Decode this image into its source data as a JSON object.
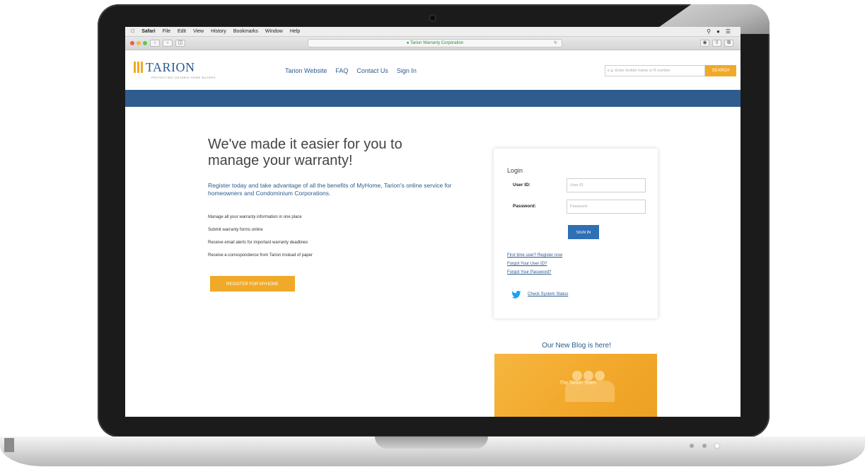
{
  "menubar": {
    "items": [
      "Safari",
      "File",
      "Edit",
      "View",
      "History",
      "Bookmarks",
      "Window",
      "Help"
    ]
  },
  "toolbar": {
    "address": "Tarion Warranty Corporation"
  },
  "header": {
    "logo_text": "TARION",
    "logo_tagline": "PROTECTING ONTARIO HOME BUYERS",
    "nav": [
      "Tarion Website",
      "FAQ",
      "Contact Us",
      "Sign In"
    ],
    "search_placeholder": "e.g. Enter builder name or B number",
    "search_button": "SEARCH"
  },
  "main": {
    "headline": "We've made it easier for you to manage your warranty!",
    "intro": "Register today and take advantage of all the benefits of MyHome, Tarion's online service for homeowners and Condominium Corporations.",
    "benefits": [
      "Manage all your warranty information in one place",
      "Submit warranty forms online",
      "Receive email alerts for important warranty deadlines",
      "Receive e-correspondence from Tarion instead of paper"
    ],
    "register_button": "REGISTER FOR MYHOME"
  },
  "login": {
    "title": "Login",
    "user_label": "User ID:",
    "user_placeholder": "User ID",
    "password_label": "Password:",
    "password_placeholder": "Password",
    "signin_button": "SIGN IN",
    "links": [
      "First time user? Register now",
      "Forgot Your User ID?",
      "Forgot Your Password?"
    ],
    "system_status": "Check System Status"
  },
  "blog": {
    "title": "Our New Blog is here!",
    "caption": "The Tarion Team"
  },
  "colors": {
    "brand_blue": "#2e5c8e",
    "accent_orange": "#f0a928",
    "button_blue": "#2e6fb5",
    "twitter_blue": "#1da1f2"
  }
}
